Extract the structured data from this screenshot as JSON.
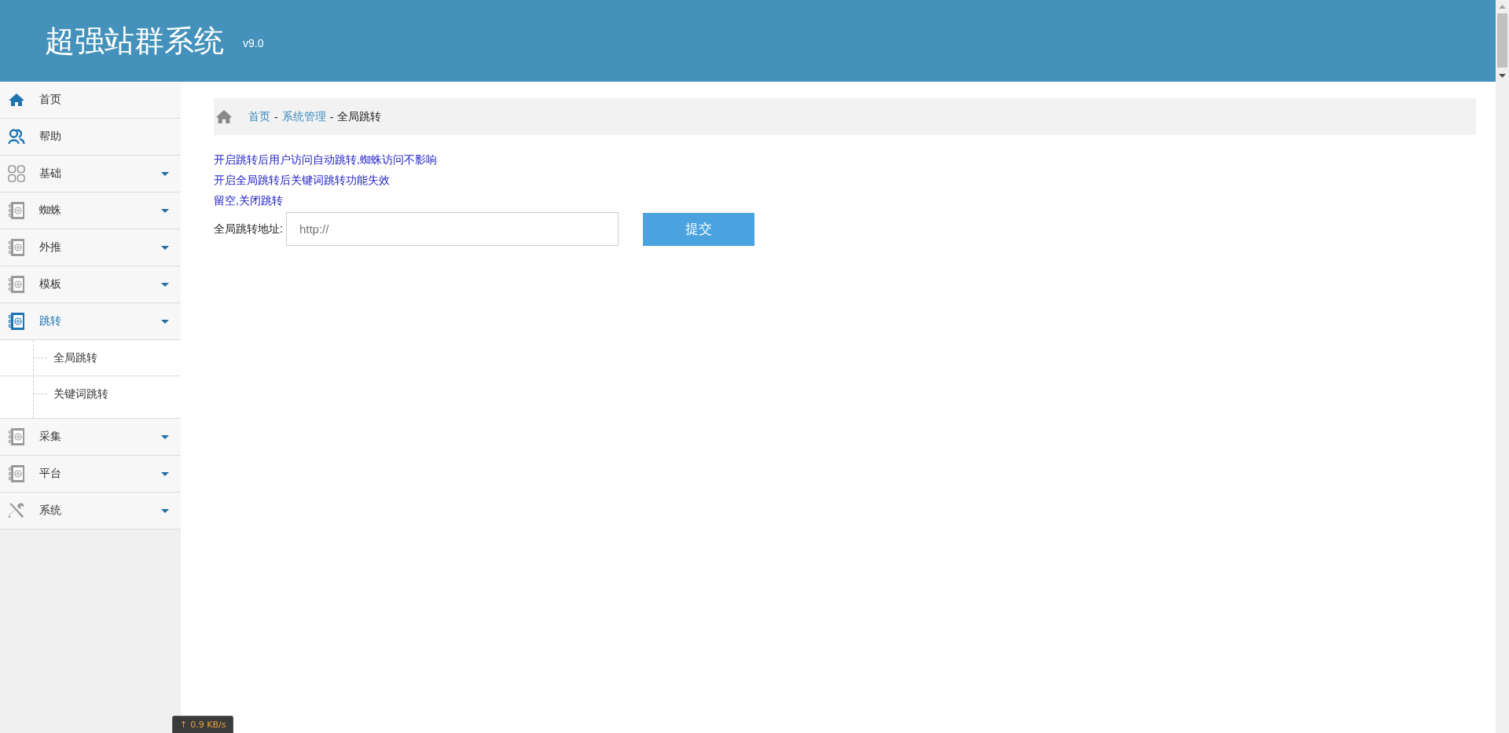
{
  "header": {
    "title": "超强站群系统",
    "version": "v9.0"
  },
  "sidebar": {
    "items": [
      {
        "label": "首页",
        "kind": "link",
        "selected": false
      },
      {
        "label": "帮助",
        "kind": "link",
        "selected": false
      },
      {
        "label": "基础",
        "kind": "group",
        "selected": false
      },
      {
        "label": "蜘蛛",
        "kind": "group",
        "selected": false
      },
      {
        "label": "外推",
        "kind": "group",
        "selected": false
      },
      {
        "label": "模板",
        "kind": "group",
        "selected": false
      },
      {
        "label": "跳转",
        "kind": "group",
        "selected": true,
        "children": [
          {
            "label": "全局跳转"
          },
          {
            "label": "关键词跳转"
          }
        ]
      },
      {
        "label": "采集",
        "kind": "group",
        "selected": false
      },
      {
        "label": "平台",
        "kind": "group",
        "selected": false
      },
      {
        "label": "系统",
        "kind": "group",
        "selected": false
      }
    ]
  },
  "breadcrumb": [
    {
      "label": "首页",
      "link": true
    },
    {
      "label": "系统管理",
      "link": true
    },
    {
      "label": "全局跳转",
      "link": false
    }
  ],
  "breadcrumb_separator": "-",
  "notes": [
    "开启跳转后用户访问自动跳转,蜘蛛访问不影响",
    "开启全局跳转后关键词跳转功能失效",
    "留空,关闭跳转"
  ],
  "form": {
    "label": "全局跳转地址:",
    "placeholder": "http://",
    "submit": "提交"
  },
  "speed_badge": {
    "arrow": "↑",
    "text": "0.9 KB/s"
  }
}
